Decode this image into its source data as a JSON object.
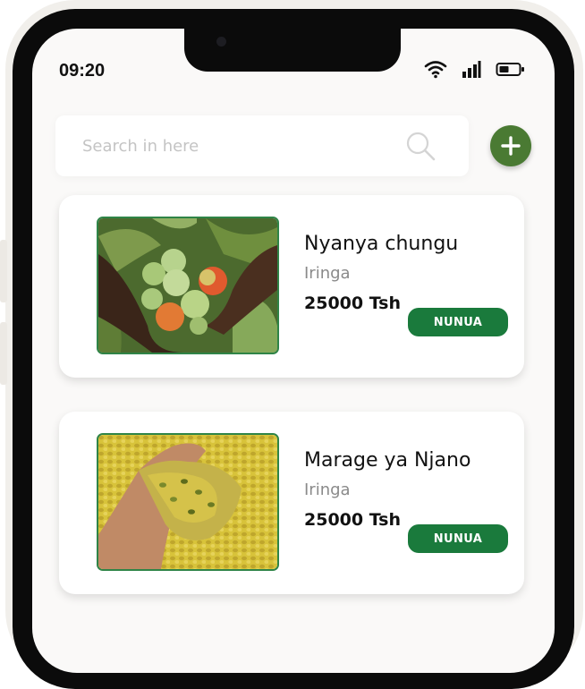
{
  "status_bar": {
    "time": "09:20",
    "icons": [
      "wifi-icon",
      "signal-icon",
      "battery-icon"
    ]
  },
  "search": {
    "placeholder": "Search in here",
    "value": "",
    "icon": "search-icon"
  },
  "add_button": {
    "icon": "plus-icon"
  },
  "products": [
    {
      "name": "Nyanya chungu",
      "location": "Iringa",
      "price": "25000 Tsh",
      "button_label": "NUNUA",
      "image": "tomatoes-in-hands"
    },
    {
      "name": "Marage ya Njano",
      "location": "Iringa",
      "price": "25000 Tsh",
      "button_label": "NUNUA",
      "image": "yellow-beans-in-hand"
    }
  ],
  "colors": {
    "accent_green": "#1a7a3c",
    "add_button_green": "#4a7a33",
    "image_border": "#2f8447",
    "screen_background": "#faf9f8"
  }
}
